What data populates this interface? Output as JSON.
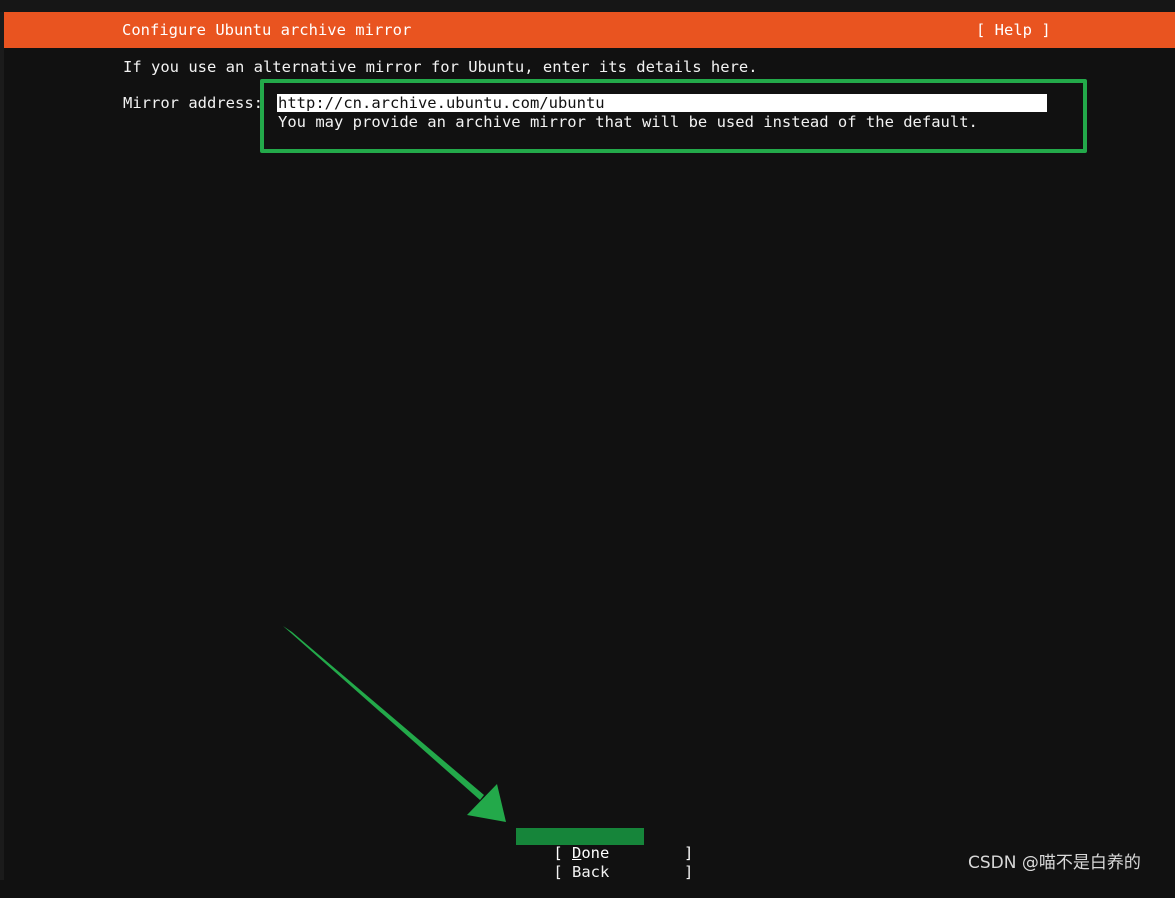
{
  "header": {
    "title": "Configure Ubuntu archive mirror",
    "help_label": "[ Help ]"
  },
  "intro": "If you use an alternative mirror for Ubuntu, enter its details here.",
  "mirror": {
    "label": "Mirror address:",
    "value": "http://cn.archive.ubuntu.com/ubuntu",
    "hint": "You may provide an archive mirror that will be used instead of the default."
  },
  "buttons": {
    "done_open": "[ ",
    "done_first": "D",
    "done_rest": "one",
    "done_close": "        ]",
    "back_open": "[ ",
    "back_label": "Back",
    "back_close": "        ]"
  },
  "watermark": "CSDN @喵不是白养的",
  "colors": {
    "header": "#e95420",
    "background": "#111111",
    "annotation_green": "#23a94a",
    "selected_button": "#16853a"
  },
  "icons": {
    "annotation_arrow": "arrow-icon"
  }
}
